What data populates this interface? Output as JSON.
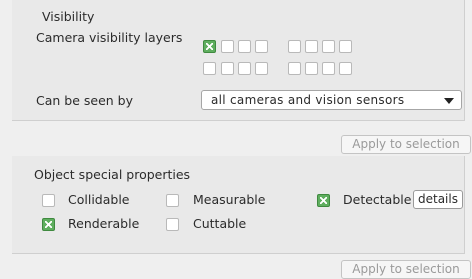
{
  "visibility": {
    "title": "Visibility",
    "camera_layers_label": "Camera visibility layers",
    "layers_row1": [
      true,
      false,
      false,
      false,
      false,
      false,
      false,
      false
    ],
    "layers_row2": [
      false,
      false,
      false,
      false,
      false,
      false,
      false,
      false
    ],
    "seen_by_label": "Can be seen by",
    "seen_by_value": "all cameras and vision sensors",
    "apply_label": "Apply to selection"
  },
  "special": {
    "title": "Object special properties",
    "items": [
      {
        "label": "Collidable",
        "checked": false
      },
      {
        "label": "Measurable",
        "checked": false
      },
      {
        "label": "Detectable",
        "checked": true
      },
      {
        "label": "Renderable",
        "checked": true
      },
      {
        "label": "Cuttable",
        "checked": false
      }
    ],
    "details_label": "details",
    "apply_label": "Apply to selection"
  }
}
